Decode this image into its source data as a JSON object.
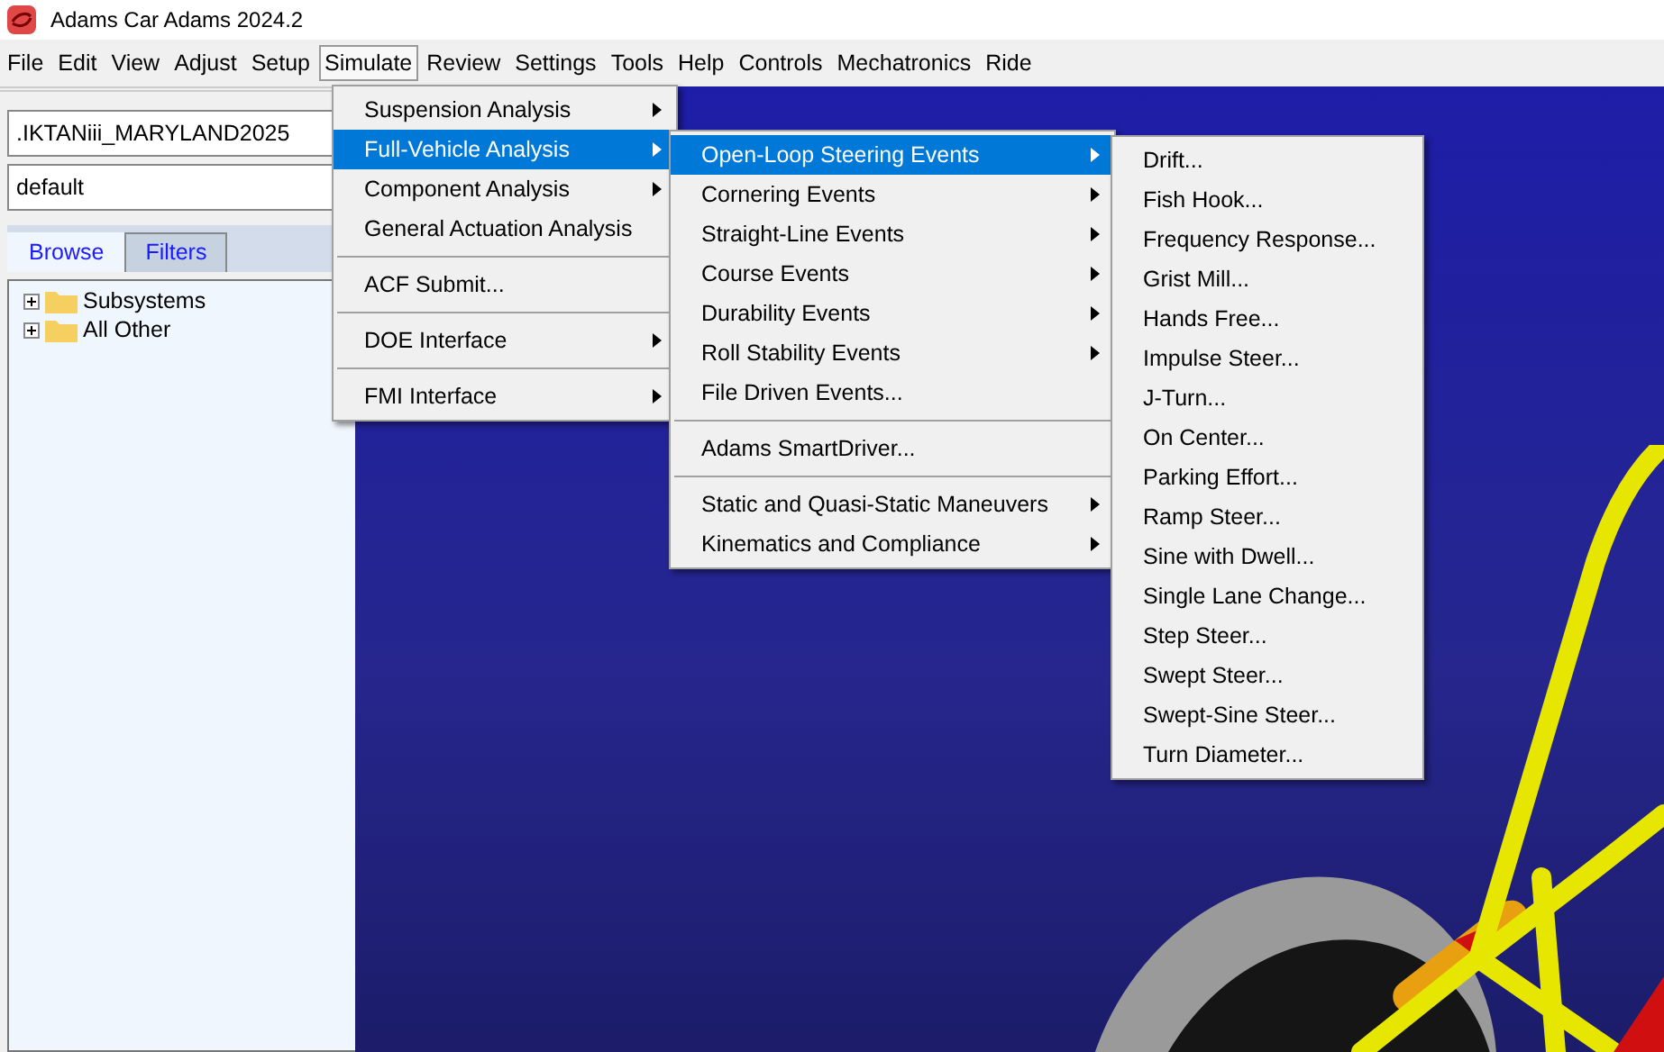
{
  "window": {
    "title": "Adams Car Adams 2024.2"
  },
  "menubar": [
    {
      "label": "File",
      "selected": false
    },
    {
      "label": "Edit",
      "selected": false
    },
    {
      "label": "View",
      "selected": false
    },
    {
      "label": "Adjust",
      "selected": false
    },
    {
      "label": "Setup",
      "selected": false
    },
    {
      "label": "Simulate",
      "selected": true
    },
    {
      "label": "Review",
      "selected": false
    },
    {
      "label": "Settings",
      "selected": false
    },
    {
      "label": "Tools",
      "selected": false
    },
    {
      "label": "Help",
      "selected": false
    },
    {
      "label": "Controls",
      "selected": false
    },
    {
      "label": "Mechatronics",
      "selected": false
    },
    {
      "label": "Ride",
      "selected": false
    }
  ],
  "sidebar": {
    "assembly_combo": ".IKTANiii_MARYLAND2025",
    "mode_combo": "default",
    "tabs": [
      {
        "label": "Browse",
        "selected": true
      },
      {
        "label": "Filters",
        "selected": false
      }
    ],
    "tree": [
      {
        "label": "Subsystems",
        "expanded": false
      },
      {
        "label": "All Other",
        "expanded": false
      }
    ]
  },
  "simulate_menu": [
    {
      "kind": "submenu",
      "label": "Suspension Analysis",
      "selected": false
    },
    {
      "kind": "submenu",
      "label": "Full-Vehicle Analysis",
      "selected": true
    },
    {
      "kind": "submenu",
      "label": "Component Analysis",
      "selected": false
    },
    {
      "kind": "item",
      "label": "General Actuation Analysis",
      "selected": false
    },
    {
      "kind": "separator"
    },
    {
      "kind": "item",
      "label": "ACF Submit...",
      "selected": false
    },
    {
      "kind": "separator"
    },
    {
      "kind": "submenu",
      "label": "DOE Interface",
      "selected": false
    },
    {
      "kind": "separator"
    },
    {
      "kind": "submenu",
      "label": "FMI Interface",
      "selected": false
    }
  ],
  "full_vehicle_menu": [
    {
      "kind": "submenu",
      "label": "Open-Loop Steering Events",
      "selected": true
    },
    {
      "kind": "submenu",
      "label": "Cornering Events",
      "selected": false
    },
    {
      "kind": "submenu",
      "label": "Straight-Line Events",
      "selected": false
    },
    {
      "kind": "submenu",
      "label": "Course Events",
      "selected": false
    },
    {
      "kind": "submenu",
      "label": "Durability Events",
      "selected": false
    },
    {
      "kind": "submenu",
      "label": "Roll Stability Events",
      "selected": false
    },
    {
      "kind": "item",
      "label": "File Driven Events...",
      "selected": false
    },
    {
      "kind": "separator"
    },
    {
      "kind": "item",
      "label": "Adams SmartDriver...",
      "selected": false
    },
    {
      "kind": "separator"
    },
    {
      "kind": "submenu",
      "label": "Static and Quasi-Static Maneuvers",
      "selected": false
    },
    {
      "kind": "submenu",
      "label": "Kinematics and Compliance",
      "selected": false
    }
  ],
  "open_loop_menu": [
    {
      "kind": "item",
      "label": "Drift...",
      "selected": false
    },
    {
      "kind": "item",
      "label": "Fish Hook...",
      "selected": false
    },
    {
      "kind": "item",
      "label": "Frequency Response...",
      "selected": false
    },
    {
      "kind": "item",
      "label": "Grist Mill...",
      "selected": false
    },
    {
      "kind": "item",
      "label": "Hands Free...",
      "selected": false
    },
    {
      "kind": "item",
      "label": "Impulse Steer...",
      "selected": false
    },
    {
      "kind": "item",
      "label": "J-Turn...",
      "selected": false
    },
    {
      "kind": "item",
      "label": "On Center...",
      "selected": false
    },
    {
      "kind": "item",
      "label": "Parking Effort...",
      "selected": false
    },
    {
      "kind": "item",
      "label": "Ramp Steer...",
      "selected": false
    },
    {
      "kind": "item",
      "label": "Sine with Dwell...",
      "selected": false
    },
    {
      "kind": "item",
      "label": "Single Lane Change...",
      "selected": false
    },
    {
      "kind": "item",
      "label": "Step Steer...",
      "selected": false
    },
    {
      "kind": "item",
      "label": "Swept Steer...",
      "selected": false
    },
    {
      "kind": "item",
      "label": "Swept-Sine Steer...",
      "selected": false
    },
    {
      "kind": "item",
      "label": "Turn Diameter...",
      "selected": false
    }
  ]
}
